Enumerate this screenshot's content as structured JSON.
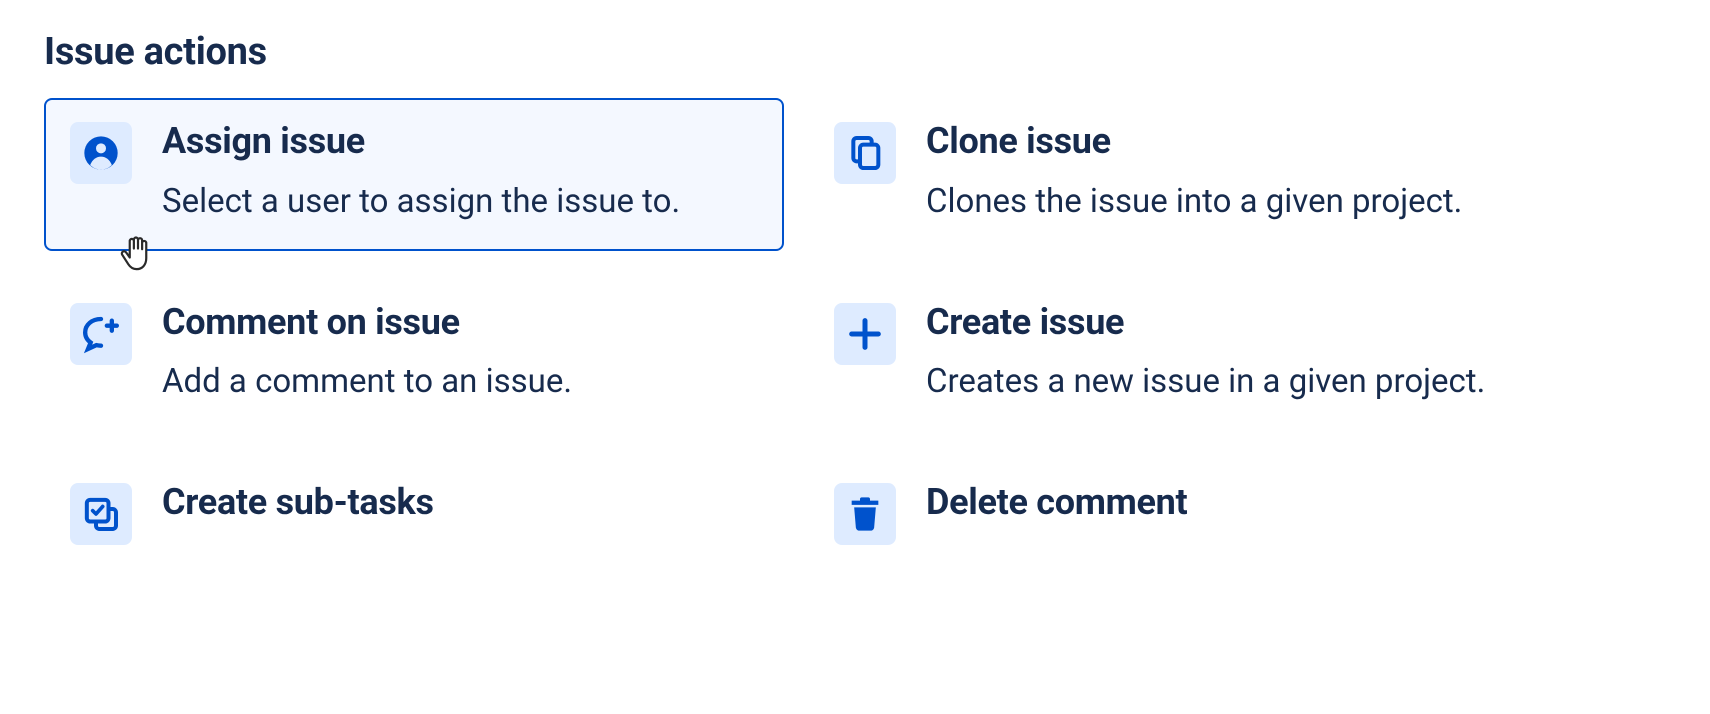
{
  "heading": "Issue actions",
  "actions": [
    {
      "title": "Assign issue",
      "desc": "Select a user to assign the issue to.",
      "icon": "person-circle-icon",
      "selected": true
    },
    {
      "title": "Clone issue",
      "desc": "Clones the issue into a given project.",
      "icon": "copy-icon",
      "selected": false
    },
    {
      "title": "Comment on issue",
      "desc": "Add a comment to an issue.",
      "icon": "comment-plus-icon",
      "selected": false
    },
    {
      "title": "Create issue",
      "desc": "Creates a new issue in a given project.",
      "icon": "plus-icon",
      "selected": false
    },
    {
      "title": "Create sub-tasks",
      "desc": "",
      "icon": "subtask-icon",
      "selected": false
    },
    {
      "title": "Delete comment",
      "desc": "",
      "icon": "trash-icon",
      "selected": false
    }
  ],
  "colors": {
    "accent": "#0052cc",
    "iconBg": "#deebff",
    "text": "#172b4d"
  }
}
